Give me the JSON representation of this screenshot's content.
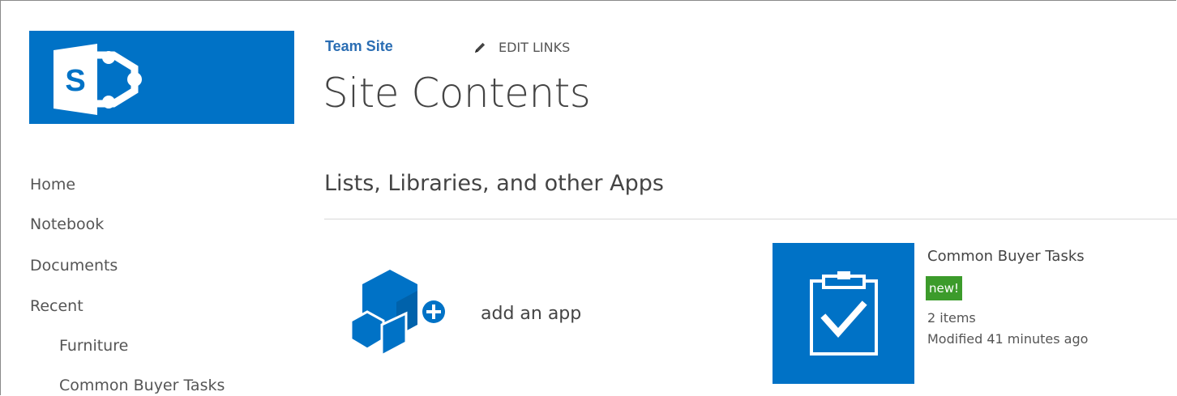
{
  "logo": {
    "letter": "S",
    "brand_color": "#0072c6",
    "icon": "sharepoint-logo-icon"
  },
  "header": {
    "site_link": "Team Site",
    "edit_links_label": "EDIT LINKS",
    "edit_icon": "pencil-icon",
    "page_title": "Site Contents"
  },
  "quick_launch": {
    "items": [
      {
        "label": "Home"
      },
      {
        "label": "Notebook"
      },
      {
        "label": "Documents"
      },
      {
        "label": "Recent"
      }
    ],
    "recent_items": [
      {
        "label": "Furniture"
      },
      {
        "label": "Common Buyer Tasks"
      }
    ]
  },
  "main": {
    "section_title": "Lists, Libraries, and other Apps",
    "add_app": {
      "label": "add an app",
      "icon": "add-app-icon"
    },
    "apps": [
      {
        "name": "Common Buyer Tasks",
        "badge": "new!",
        "item_count": "2 items",
        "modified": "Modified 41 minutes ago",
        "icon": "task-list-icon",
        "badge_color": "#3c9b2b"
      }
    ]
  }
}
